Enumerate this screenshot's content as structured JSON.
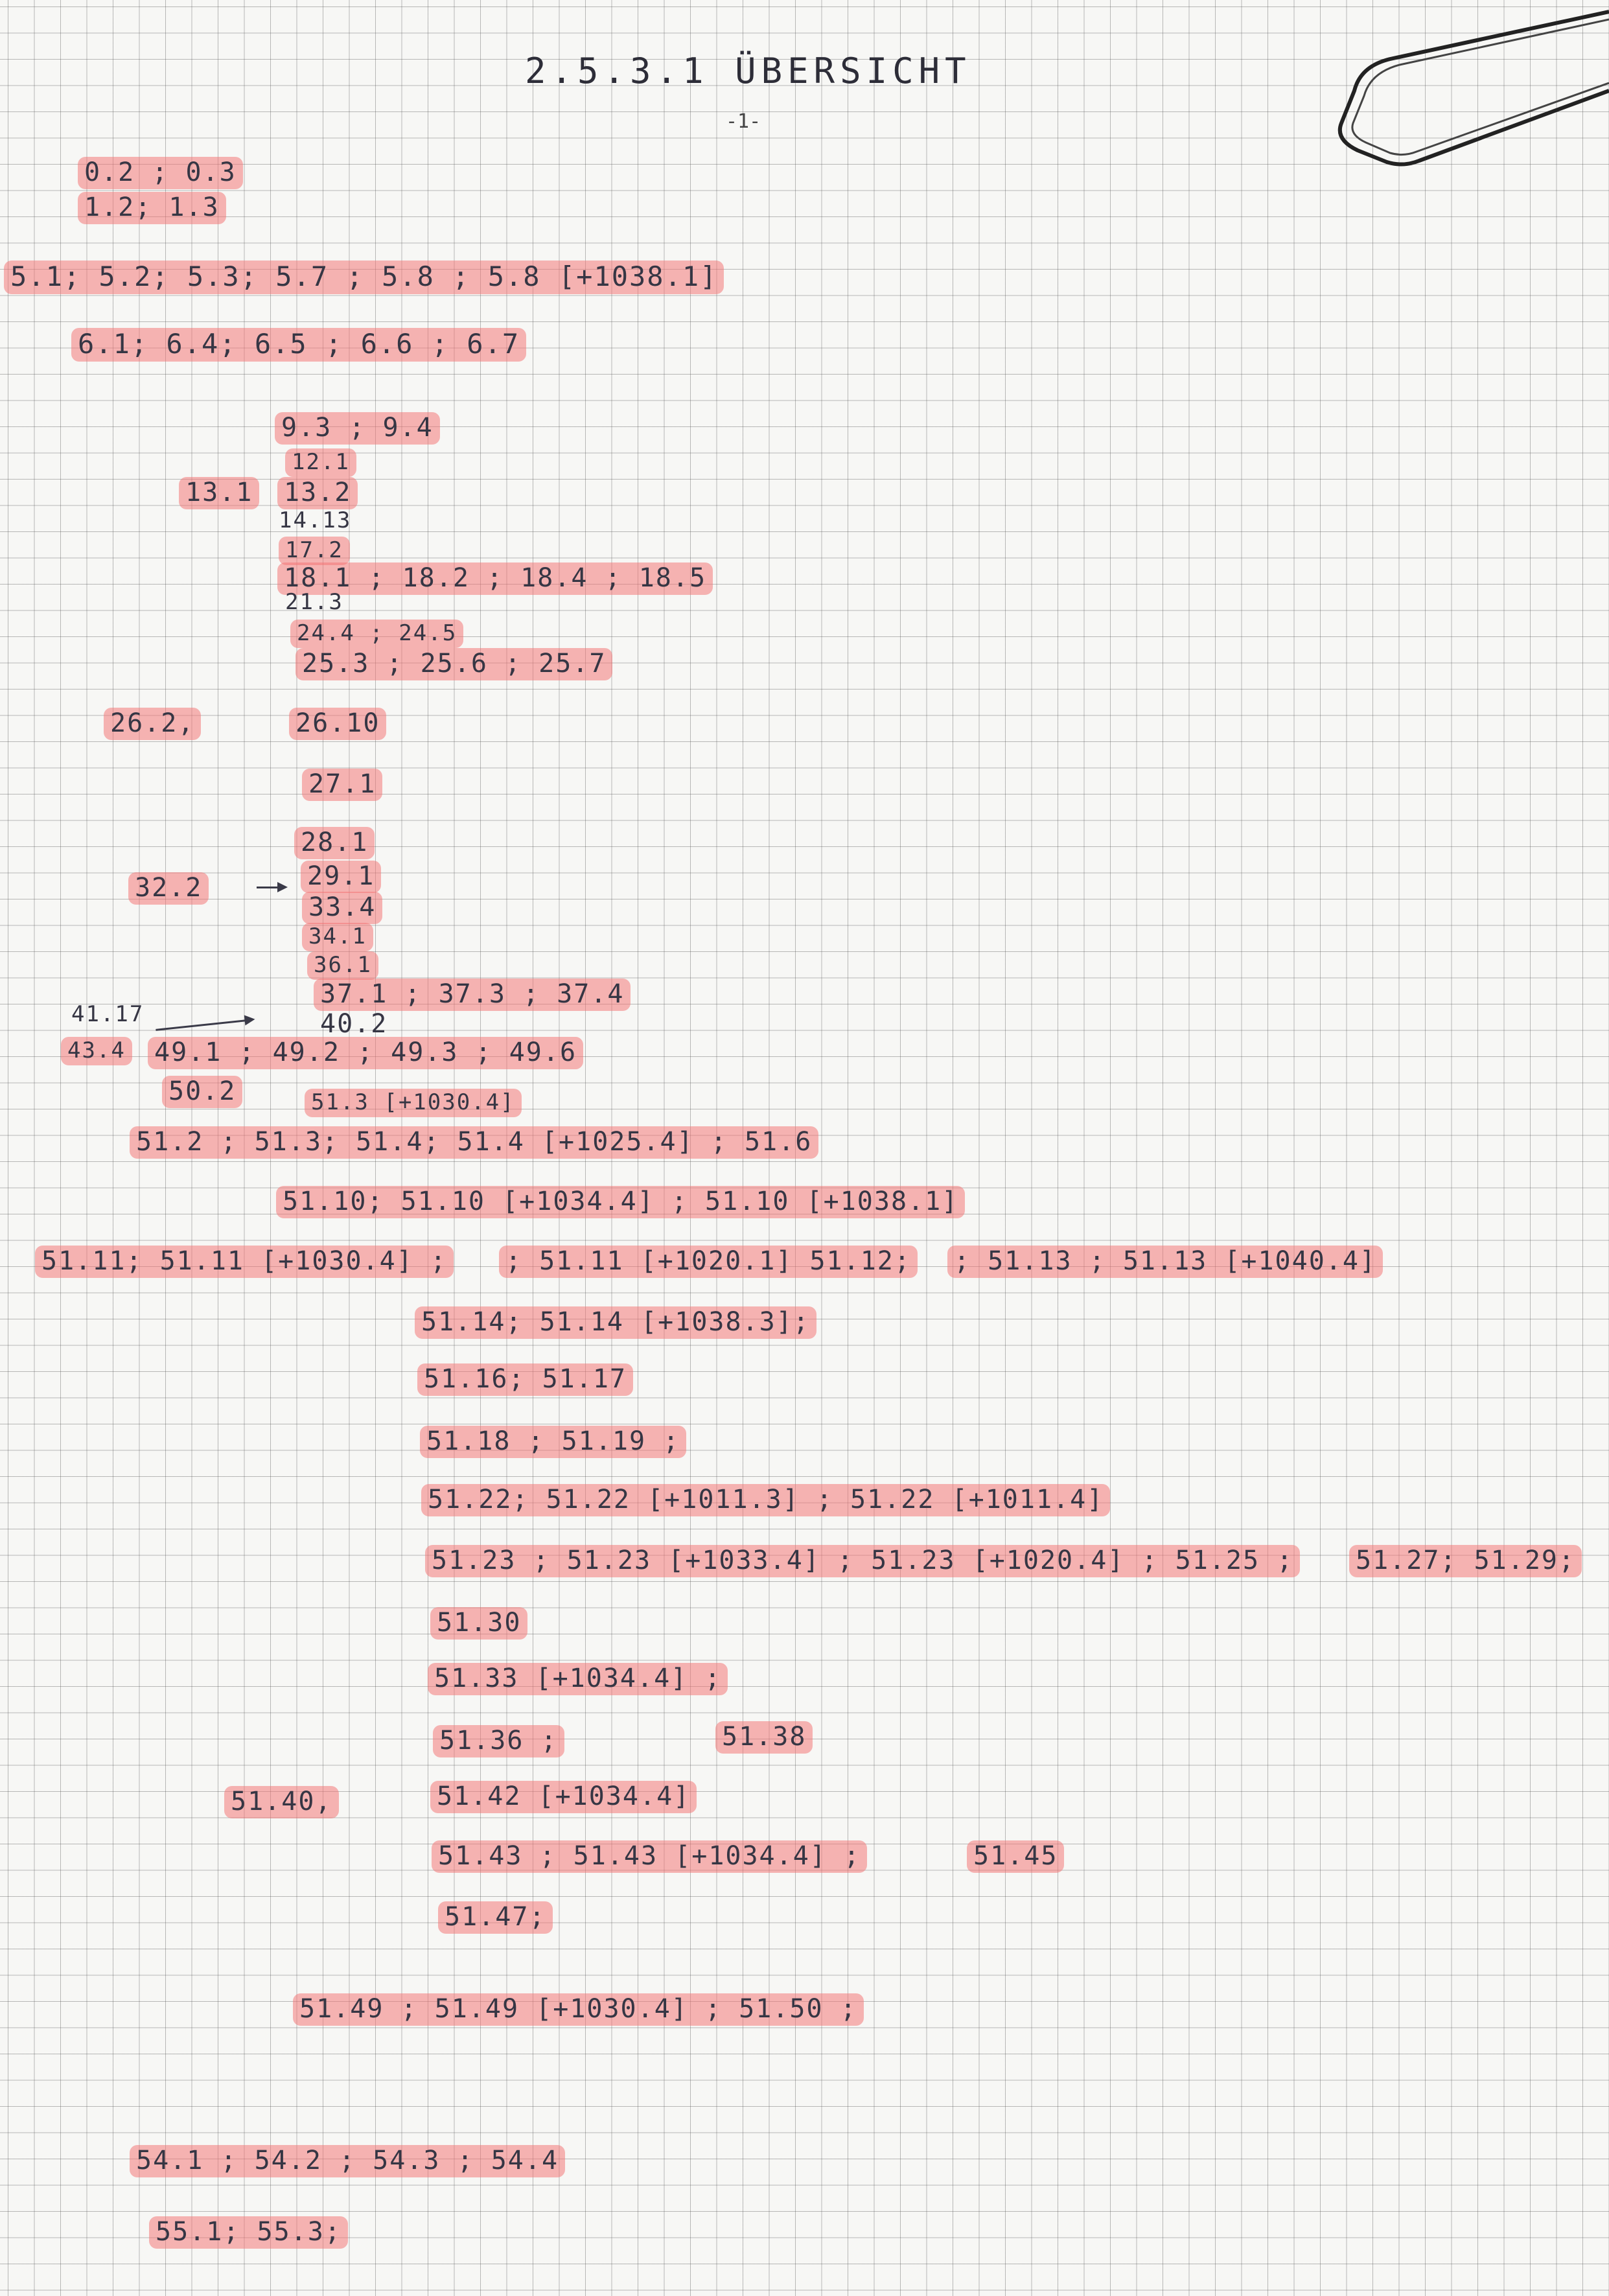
{
  "header": {
    "title": "2.5.3.1 ÜBERSICHT",
    "page_number": "-1-"
  },
  "entries": [
    {
      "text": "0.2 ; 0.3",
      "highlight": true
    },
    {
      "text": "1.2; 1.3",
      "highlight": true
    },
    {
      "text": "5.1; 5.2; 5.3; 5.7 ; 5.8 ; 5.8 [+1038.1]",
      "highlight": true
    },
    {
      "text": "6.1; 6.4; 6.5 ; 6.6 ; 6.7",
      "highlight": true
    },
    {
      "text": "9.3 ; 9.4",
      "highlight": true
    },
    {
      "text": "12.1",
      "highlight": true
    },
    {
      "text": "13.1",
      "highlight": true
    },
    {
      "text": "13.2",
      "highlight": true
    },
    {
      "text": "14.13",
      "highlight": false
    },
    {
      "text": "17.2",
      "highlight": true
    },
    {
      "text": "18.1 ; 18.2 ; 18.4 ; 18.5",
      "highlight": true
    },
    {
      "text": "21.3",
      "highlight": false
    },
    {
      "text": "24.4 ; 24.5",
      "highlight": true
    },
    {
      "text": "25.3 ; 25.6 ; 25.7",
      "highlight": true
    },
    {
      "text": "26.2,",
      "highlight": true
    },
    {
      "text": "26.10",
      "highlight": true
    },
    {
      "text": "27.1",
      "highlight": true
    },
    {
      "text": "28.1",
      "highlight": true
    },
    {
      "text": "32.2",
      "highlight": true
    },
    {
      "text": "29.1",
      "highlight": true
    },
    {
      "text": "33.4",
      "highlight": true
    },
    {
      "text": "34.1",
      "highlight": true
    },
    {
      "text": "36.1",
      "highlight": true
    },
    {
      "text": "37.1 ; 37.3 ; 37.4",
      "highlight": true
    },
    {
      "text": "41.17",
      "highlight": false
    },
    {
      "text": "40.2",
      "highlight": false
    },
    {
      "text": "43.4",
      "highlight": true
    },
    {
      "text": "49.1 ; 49.2 ; 49.3 ; 49.6",
      "highlight": true
    },
    {
      "text": "50.2",
      "highlight": true
    },
    {
      "text": "51.3 [+1030.4]",
      "highlight": true
    },
    {
      "text": "51.2 ; 51.3; 51.4; 51.4 [+1025.4] ; 51.6",
      "highlight": true
    },
    {
      "text": "51.10; 51.10 [+1034.4] ; 51.10 [+1038.1]",
      "highlight": true
    },
    {
      "text": "51.11; 51.11 [+1030.4] ;",
      "highlight": true
    },
    {
      "text": "; 51.11 [+1020.1] 51.12;",
      "highlight": true
    },
    {
      "text": "; 51.13 ; 51.13 [+1040.4]",
      "highlight": true
    },
    {
      "text": "51.14; 51.14 [+1038.3];",
      "highlight": true
    },
    {
      "text": "51.16; 51.17",
      "highlight": true
    },
    {
      "text": "51.18 ; 51.19 ;",
      "highlight": true
    },
    {
      "text": "51.22; 51.22 [+1011.3] ; 51.22 [+1011.4]",
      "highlight": true
    },
    {
      "text": "51.23 ; 51.23 [+1033.4] ; 51.23 [+1020.4] ; 51.25 ;",
      "highlight": true
    },
    {
      "text": "51.27; 51.29;",
      "highlight": true
    },
    {
      "text": "51.30",
      "highlight": true
    },
    {
      "text": "51.33 [+1034.4] ;",
      "highlight": true
    },
    {
      "text": "51.36 ;",
      "highlight": true
    },
    {
      "text": "51.38",
      "highlight": true
    },
    {
      "text": "51.40,",
      "highlight": true
    },
    {
      "text": "51.42 [+1034.4]",
      "highlight": true
    },
    {
      "text": "51.43 ; 51.43 [+1034.4] ;",
      "highlight": true
    },
    {
      "text": "51.45",
      "highlight": true
    },
    {
      "text": "51.47;",
      "highlight": true
    },
    {
      "text": "51.49 ; 51.49 [+1030.4] ; 51.50 ;",
      "highlight": true
    },
    {
      "text": "54.1 ; 54.2 ; 54.3 ; 54.4",
      "highlight": true
    },
    {
      "text": "55.1; 55.3;",
      "highlight": true
    }
  ]
}
